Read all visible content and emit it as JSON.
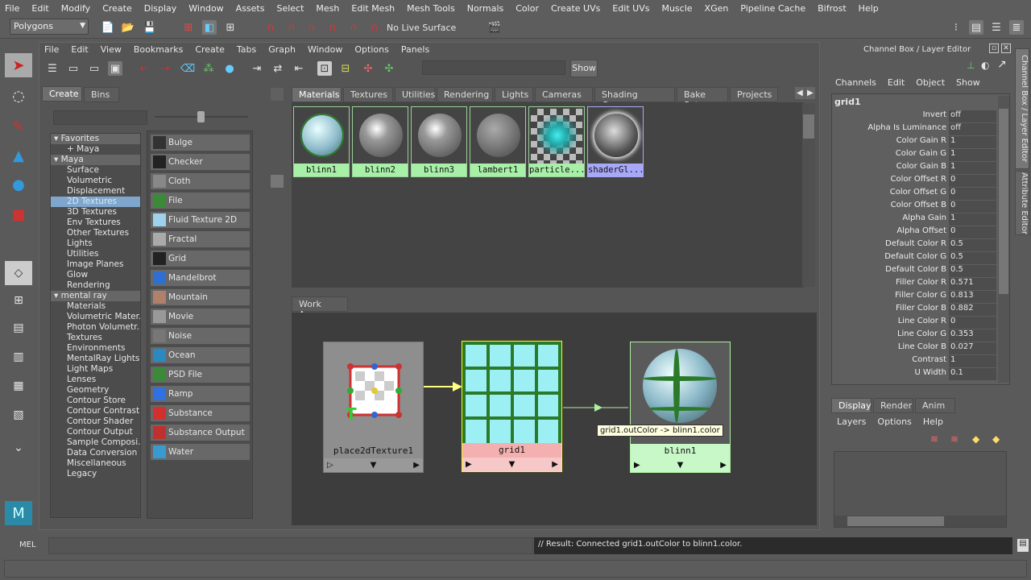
{
  "main_menu": [
    "File",
    "Edit",
    "Modify",
    "Create",
    "Display",
    "Window",
    "Assets",
    "Select",
    "Mesh",
    "Edit Mesh",
    "Mesh Tools",
    "Normals",
    "Color",
    "Create UVs",
    "Edit UVs",
    "Muscle",
    "XGen",
    "Pipeline Cache",
    "Bifrost",
    "Help"
  ],
  "toolbar": {
    "menu_set": "Polygons",
    "live_surface": "No Live Surface"
  },
  "hypershade": {
    "menu": [
      "File",
      "Edit",
      "View",
      "Bookmarks",
      "Create",
      "Tabs",
      "Graph",
      "Window",
      "Options",
      "Panels"
    ],
    "show_button": "Show",
    "left_tabs": [
      "Create",
      "Bins"
    ],
    "tree": [
      {
        "label": "Favorites",
        "type": "header"
      },
      {
        "label": "+ Maya",
        "type": "item"
      },
      {
        "label": "Maya",
        "type": "header"
      },
      {
        "label": "Surface",
        "type": "item"
      },
      {
        "label": "Volumetric",
        "type": "item"
      },
      {
        "label": "Displacement",
        "type": "item"
      },
      {
        "label": "2D Textures",
        "type": "selected"
      },
      {
        "label": "3D Textures",
        "type": "item"
      },
      {
        "label": "Env Textures",
        "type": "item"
      },
      {
        "label": "Other Textures",
        "type": "item"
      },
      {
        "label": "Lights",
        "type": "item"
      },
      {
        "label": "Utilities",
        "type": "item"
      },
      {
        "label": "Image Planes",
        "type": "item"
      },
      {
        "label": "Glow",
        "type": "item"
      },
      {
        "label": "Rendering",
        "type": "item"
      },
      {
        "label": "mental ray",
        "type": "header"
      },
      {
        "label": "Materials",
        "type": "item"
      },
      {
        "label": "Volumetric Mater...",
        "type": "item"
      },
      {
        "label": "Photon Volumetr...",
        "type": "item"
      },
      {
        "label": "Textures",
        "type": "item"
      },
      {
        "label": "Environments",
        "type": "item"
      },
      {
        "label": "MentalRay Lights",
        "type": "item"
      },
      {
        "label": "Light Maps",
        "type": "item"
      },
      {
        "label": "Lenses",
        "type": "item"
      },
      {
        "label": "Geometry",
        "type": "item"
      },
      {
        "label": "Contour Store",
        "type": "item"
      },
      {
        "label": "Contour Contrast",
        "type": "item"
      },
      {
        "label": "Contour Shader",
        "type": "item"
      },
      {
        "label": "Contour Output",
        "type": "item"
      },
      {
        "label": "Sample Composi...",
        "type": "item"
      },
      {
        "label": "Data Conversion",
        "type": "item"
      },
      {
        "label": "Miscellaneous",
        "type": "item"
      },
      {
        "label": "Legacy",
        "type": "item"
      }
    ],
    "node_buttons": [
      {
        "label": "Bulge",
        "color": "#333"
      },
      {
        "label": "Checker",
        "color": "#222"
      },
      {
        "label": "Cloth",
        "color": "#888"
      },
      {
        "label": "File",
        "color": "#3a8a3a"
      },
      {
        "label": "Fluid Texture 2D",
        "color": "#9fd0ee"
      },
      {
        "label": "Fractal",
        "color": "#aaa"
      },
      {
        "label": "Grid",
        "color": "#222"
      },
      {
        "label": "Mandelbrot",
        "color": "#2f6fd0"
      },
      {
        "label": "Mountain",
        "color": "#b0806a"
      },
      {
        "label": "Movie",
        "color": "#999"
      },
      {
        "label": "Noise",
        "color": "#777"
      },
      {
        "label": "Ocean",
        "color": "#2a8ac0"
      },
      {
        "label": "PSD File",
        "color": "#3a8a3a"
      },
      {
        "label": "Ramp",
        "color": "#3070e0"
      },
      {
        "label": "Substance",
        "color": "#d03030"
      },
      {
        "label": "Substance Output",
        "color": "#c03030"
      },
      {
        "label": "Water",
        "color": "#3a9ad0"
      }
    ],
    "top_tabs": [
      "Materials",
      "Textures",
      "Utilities",
      "Rendering",
      "Lights",
      "Cameras",
      "Shading Groups",
      "Bake Sets",
      "Projects"
    ],
    "swatches": [
      {
        "label": "blinn1",
        "kind": "grid-ball"
      },
      {
        "label": "blinn2",
        "kind": "ball"
      },
      {
        "label": "blinn3",
        "kind": "ball"
      },
      {
        "label": "lambert1",
        "kind": "matte"
      },
      {
        "label": "particle...",
        "kind": "particle"
      },
      {
        "label": "shaderGl...",
        "kind": "glow",
        "selected": true
      }
    ],
    "work_area_tab": "Work Area",
    "nodes": {
      "place2d": "place2dTexture1",
      "grid": "grid1",
      "blinn": "blinn1"
    },
    "tooltip": "grid1.outColor -> blinn1.color"
  },
  "channel_box": {
    "title": "Channel Box / Layer Editor",
    "menu": [
      "Channels",
      "Edit",
      "Object",
      "Show"
    ],
    "node": "grid1",
    "attributes": [
      {
        "name": "Invert",
        "value": "off"
      },
      {
        "name": "Alpha Is Luminance",
        "value": "off"
      },
      {
        "name": "Color Gain R",
        "value": "1"
      },
      {
        "name": "Color Gain G",
        "value": "1"
      },
      {
        "name": "Color Gain B",
        "value": "1"
      },
      {
        "name": "Color Offset R",
        "value": "0"
      },
      {
        "name": "Color Offset G",
        "value": "0"
      },
      {
        "name": "Color Offset B",
        "value": "0"
      },
      {
        "name": "Alpha Gain",
        "value": "1"
      },
      {
        "name": "Alpha Offset",
        "value": "0"
      },
      {
        "name": "Default Color R",
        "value": "0.5"
      },
      {
        "name": "Default Color G",
        "value": "0.5"
      },
      {
        "name": "Default Color B",
        "value": "0.5"
      },
      {
        "name": "Filler Color R",
        "value": "0.571"
      },
      {
        "name": "Filler Color G",
        "value": "0.813"
      },
      {
        "name": "Filler Color B",
        "value": "0.882"
      },
      {
        "name": "Line Color R",
        "value": "0"
      },
      {
        "name": "Line Color G",
        "value": "0.353"
      },
      {
        "name": "Line Color B",
        "value": "0.027"
      },
      {
        "name": "Contrast",
        "value": "1"
      },
      {
        "name": "U Width",
        "value": "0.1"
      }
    ],
    "layer_tabs": [
      "Display",
      "Render",
      "Anim"
    ],
    "layer_menu": [
      "Layers",
      "Options",
      "Help"
    ]
  },
  "side_tabs": [
    "Channel Box / Layer Editor",
    "Attribute Editor"
  ],
  "command_line": {
    "label": "MEL",
    "result": "// Result: Connected grid1.outColor to blinn1.color."
  }
}
